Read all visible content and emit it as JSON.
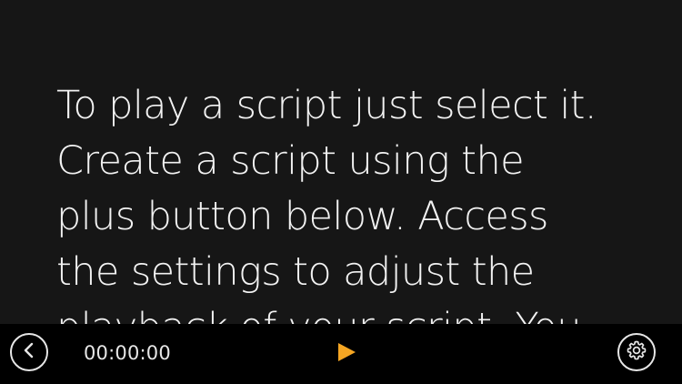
{
  "script": {
    "text": "To play a script just select it.\nCreate a script using the\nplus button below. Access\nthe settings to adjust the\nplayback of your script. You"
  },
  "toolbar": {
    "timer": "00:00:00",
    "back_icon": "chevron-left-icon",
    "play_icon": "play-icon",
    "settings_icon": "gear-icon",
    "play_color": "#f5a623",
    "icon_color": "#e6e6e6"
  }
}
